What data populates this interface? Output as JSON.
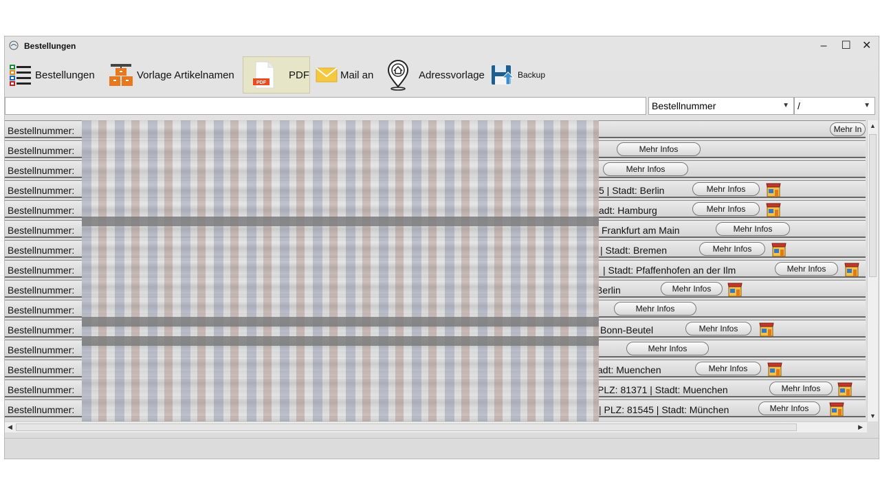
{
  "window": {
    "title": "Bestellungen",
    "controls": {
      "minimize": "–",
      "maximize": "☐",
      "close": "✕"
    }
  },
  "toolbar": {
    "orders_label": "Bestellungen",
    "template_label": "Vorlage Artikelnamen",
    "pdf_label": "PDF",
    "pdf_badge": "PDF",
    "mail_label": "Mail an",
    "address_label": "Adressvorlage",
    "backup_label": "Backup"
  },
  "filter": {
    "search_value": "",
    "field_select": "Bestellnummer",
    "operator_select": "/"
  },
  "list": {
    "rows": [
      {
        "label": "Bestellnummer:",
        "tail": "",
        "button": "Mehr In",
        "store": false
      },
      {
        "label": "Bestellnummer:",
        "tail": "",
        "button": "Mehr Infos",
        "store": false
      },
      {
        "label": "Bestellnummer:",
        "tail": "",
        "button": "Mehr Infos",
        "store": false
      },
      {
        "label": "Bestellnummer:",
        "tail": "5 | Stadt: Berlin",
        "button": "Mehr Infos",
        "store": true
      },
      {
        "label": "Bestellnummer:",
        "tail": "adt: Hamburg",
        "button": "Mehr Infos",
        "store": true
      },
      {
        "label": "Bestellnummer:",
        "tail": " Frankfurt am Main",
        "button": "Mehr Infos",
        "store": false
      },
      {
        "label": "Bestellnummer:",
        "tail": "| Stadt: Bremen",
        "button": "Mehr Infos",
        "store": true
      },
      {
        "label": "Bestellnummer:",
        "tail": "| Stadt: Pfaffenhofen an der Ilm",
        "button": "Mehr Infos",
        "store": true
      },
      {
        "label": "Bestellnummer:",
        "tail": "Berlin",
        "button": "Mehr Infos",
        "store": true
      },
      {
        "label": "Bestellnummer:",
        "tail": "",
        "button": "Mehr Infos",
        "store": false
      },
      {
        "label": "Bestellnummer:",
        "tail": " Bonn-Beutel",
        "button": "Mehr Infos",
        "store": true
      },
      {
        "label": "Bestellnummer:",
        "tail": "",
        "button": "Mehr Infos",
        "store": false
      },
      {
        "label": "Bestellnummer:",
        "tail": "adt: Muenchen",
        "button": "Mehr Infos",
        "store": true
      },
      {
        "label": "Bestellnummer:",
        "tail": " PLZ: 81371  | Stadt: Muenchen",
        "button": "Mehr Infos",
        "store": true
      },
      {
        "label": "Bestellnummer:",
        "tail": "| PLZ: 81545 | Stadt: München",
        "button": "Mehr Infos",
        "store": true
      }
    ]
  },
  "colors": {
    "pdf_badge": "#e94b22",
    "active_tool_bg": "#e6e5c8",
    "mail_icon": "#f5c842",
    "store_roof": "#c0392b"
  }
}
